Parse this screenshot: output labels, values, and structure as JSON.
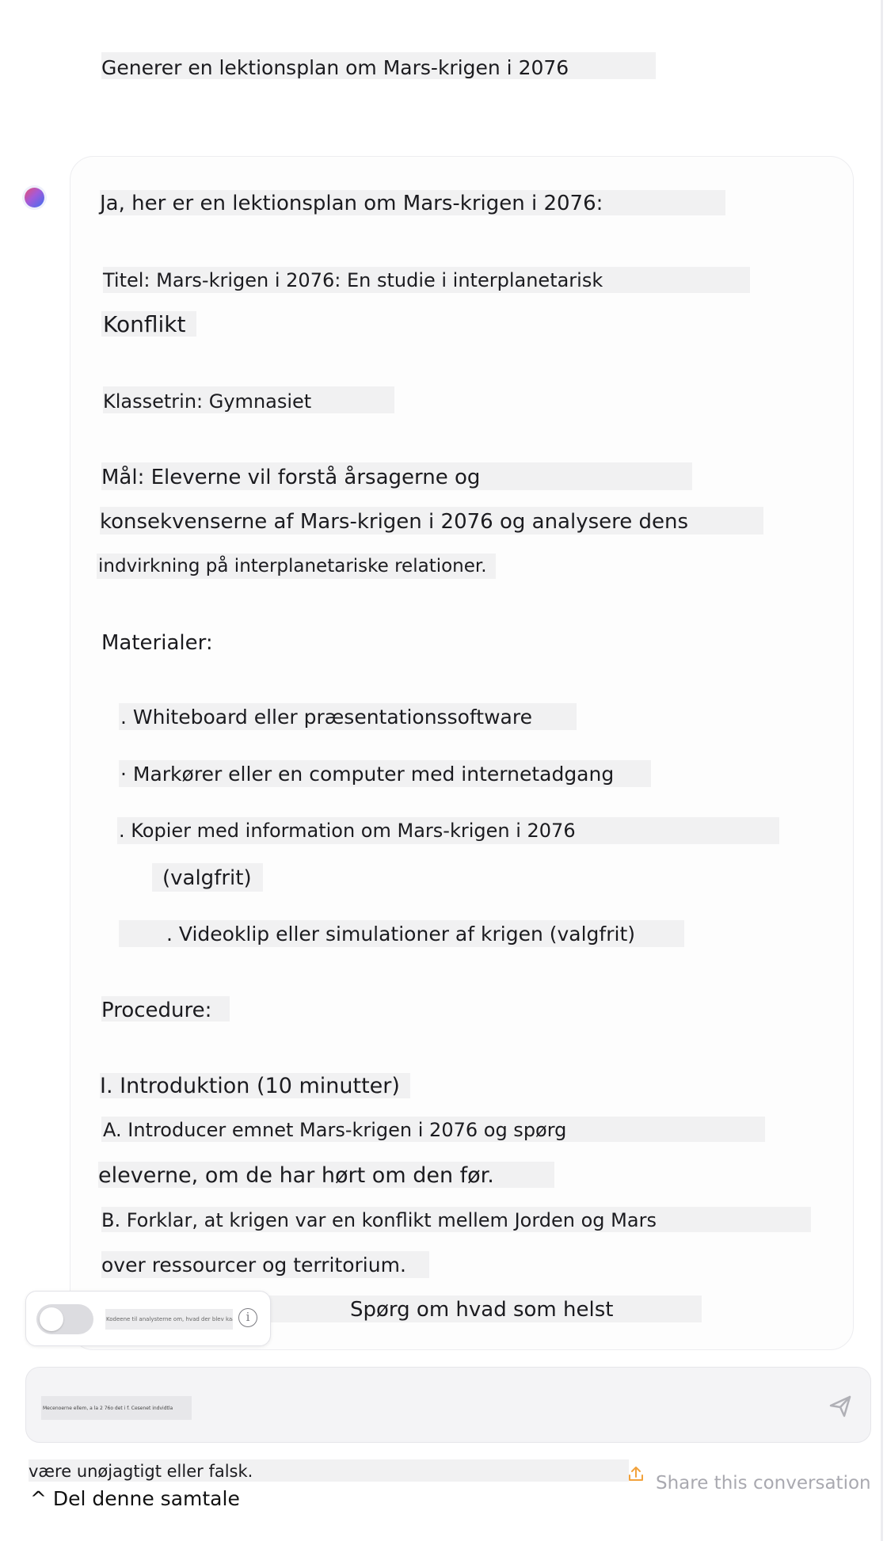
{
  "user_message": {
    "text": "Generer en lektionsplan om Mars-krigen i 2076"
  },
  "assistant": {
    "avatar": "assistant-gradient-dot-icon",
    "intro": "Ja, her er en lektionsplan om Mars-krigen i 2076:",
    "title_line1": "Titel: Mars-krigen i 2076: En studie i interplanetarisk",
    "title_line2": "Konflikt",
    "grade": "Klassetrin: Gymnasiet",
    "goal_line1": "Mål: Eleverne vil forstå årsagerne og",
    "goal_line2": "konsekvenserne af Mars-krigen i 2076 og analysere dens",
    "goal_line3": "indvirkning på interplanetariske relationer.",
    "materials_heading": "Materialer:",
    "materials": [
      ". Whiteboard eller præsentationssoftware",
      "· Markører eller en computer med internetadgang",
      ". Kopier med information om Mars-krigen i 2076",
      "(valgfrit)",
      ". Videoklip eller simulationer af krigen (valgfrit)"
    ],
    "procedure_heading": "Procedure:",
    "section1_heading": "I. Introduktion (10 minutter)",
    "step_a_line1": "A. Introducer emnet Mars-krigen i 2076 og spørg",
    "step_a_line2": "eleverne, om de har hørt om den før.",
    "step_b_line1": "B. Forklar, at krigen var en konflikt mellem Jorden og Mars",
    "step_b_line2": "over ressourcer og territorium."
  },
  "overlay_prompt": "Spørg om hvad som helst",
  "toggle": {
    "state": "off",
    "label": "Kodeene til analysterne om, hvad der blev kaaeen",
    "info_icon": "info-icon"
  },
  "composer": {
    "value": "Mecenoerne ellem, a la 2 76o det i f. Cesenet indvidtla",
    "send_icon": "send-icon"
  },
  "footer": {
    "disclaimer": "være unøjagtigt eller falsk.",
    "share_label": "Share this conversation",
    "share_icon": "share-upload-icon",
    "share_color": "#f2a23c",
    "share_danish": "^ Del denne samtale"
  }
}
